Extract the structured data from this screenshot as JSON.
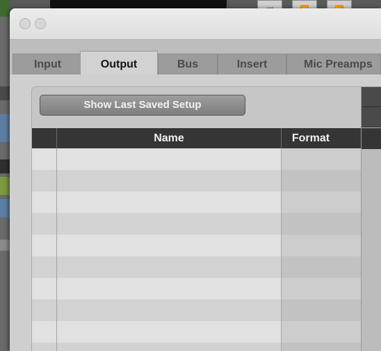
{
  "window": {
    "tabs": [
      {
        "label": "Input"
      },
      {
        "label": "Output"
      },
      {
        "label": "Bus"
      },
      {
        "label": "Insert"
      },
      {
        "label": "Mic Preamps"
      }
    ],
    "active_tab": "Output"
  },
  "toolbar": {
    "show_saved_label": "Show Last Saved Setup"
  },
  "table": {
    "columns": [
      {
        "label": ""
      },
      {
        "label": "Name"
      },
      {
        "label": "Format"
      }
    ],
    "rows": [
      {
        "name": "",
        "format": ""
      },
      {
        "name": "",
        "format": ""
      },
      {
        "name": "",
        "format": ""
      },
      {
        "name": "",
        "format": ""
      },
      {
        "name": "",
        "format": ""
      },
      {
        "name": "",
        "format": ""
      },
      {
        "name": "",
        "format": ""
      },
      {
        "name": "",
        "format": ""
      },
      {
        "name": "",
        "format": ""
      },
      {
        "name": "",
        "format": ""
      }
    ]
  },
  "background": {
    "transport_labels": [
      "⏮",
      "⏪",
      "⏩"
    ]
  },
  "colors": {
    "table_header": "#353535",
    "button": "#8e8e8e",
    "active_tab": "#d2d2d2",
    "inactive_tab": "#9c9c9c"
  }
}
